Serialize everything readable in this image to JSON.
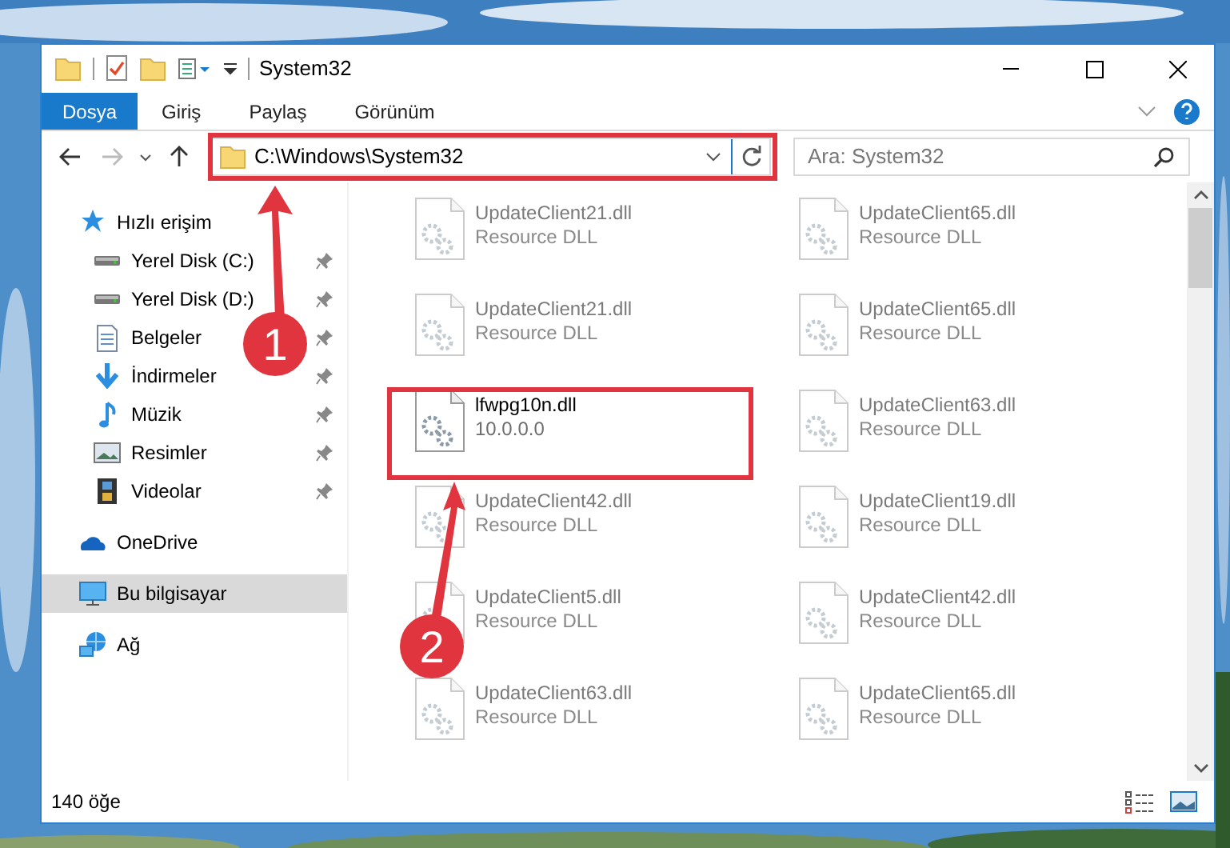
{
  "window": {
    "title": "System32"
  },
  "ribbon_tabs": [
    {
      "label": "Dosya",
      "kind": "file",
      "selected": false
    },
    {
      "label": "Giriş",
      "kind": "tab",
      "selected": false
    },
    {
      "label": "Paylaş",
      "kind": "tab",
      "selected": false
    },
    {
      "label": "Görünüm",
      "kind": "tab",
      "selected": false
    }
  ],
  "address_bar": {
    "path": "C:\\Windows\\System32"
  },
  "search": {
    "placeholder": "Ara: System32"
  },
  "sidebar": {
    "items": [
      {
        "label": "Hızlı erişim",
        "kind": "quick",
        "selected": false,
        "children": [
          {
            "label": "Yerel Disk (C:)",
            "kind": "drive",
            "pinned": true,
            "selected": false
          },
          {
            "label": "Yerel Disk (D:)",
            "kind": "drive",
            "pinned": true,
            "selected": false
          },
          {
            "label": "Belgeler",
            "kind": "docs",
            "pinned": true,
            "selected": false
          },
          {
            "label": "İndirmeler",
            "kind": "download",
            "pinned": true,
            "selected": false
          },
          {
            "label": "Müzik",
            "kind": "music",
            "pinned": true,
            "selected": false
          },
          {
            "label": "Resimler",
            "kind": "pictures",
            "pinned": true,
            "selected": false
          },
          {
            "label": "Videolar",
            "kind": "videos",
            "pinned": true,
            "selected": false
          }
        ]
      },
      {
        "label": "OneDrive",
        "kind": "cloud",
        "selected": false
      },
      {
        "label": "Bu bilgisayar",
        "kind": "pc",
        "selected": true
      },
      {
        "label": "Ağ",
        "kind": "network",
        "selected": false
      }
    ]
  },
  "files": [
    {
      "name": "UpdateClient21.dll",
      "detail": "Resource DLL",
      "blurred": true
    },
    {
      "name": "UpdateClient65.dll",
      "detail": "Resource DLL",
      "blurred": true
    },
    {
      "name": "UpdateClient21.dll",
      "detail": "Resource DLL",
      "blurred": true
    },
    {
      "name": "UpdateClient65.dll",
      "detail": "Resource DLL",
      "blurred": true
    },
    {
      "name": "lfwpg10n.dll",
      "detail": "10.0.0.0",
      "blurred": false
    },
    {
      "name": "UpdateClient63.dll",
      "detail": "Resource DLL",
      "blurred": true
    },
    {
      "name": "UpdateClient42.dll",
      "detail": "Resource DLL",
      "blurred": true
    },
    {
      "name": "UpdateClient19.dll",
      "detail": "Resource DLL",
      "blurred": true
    },
    {
      "name": "UpdateClient5.dll",
      "detail": "Resource DLL",
      "blurred": true
    },
    {
      "name": "UpdateClient42.dll",
      "detail": "Resource DLL",
      "blurred": true
    },
    {
      "name": "UpdateClient63.dll",
      "detail": "Resource DLL",
      "blurred": true
    },
    {
      "name": "UpdateClient65.dll",
      "detail": "Resource DLL",
      "blurred": true
    }
  ],
  "status_bar": {
    "item_count": "140 öğe"
  },
  "annotations": [
    {
      "number": "1"
    },
    {
      "number": "2"
    }
  ]
}
